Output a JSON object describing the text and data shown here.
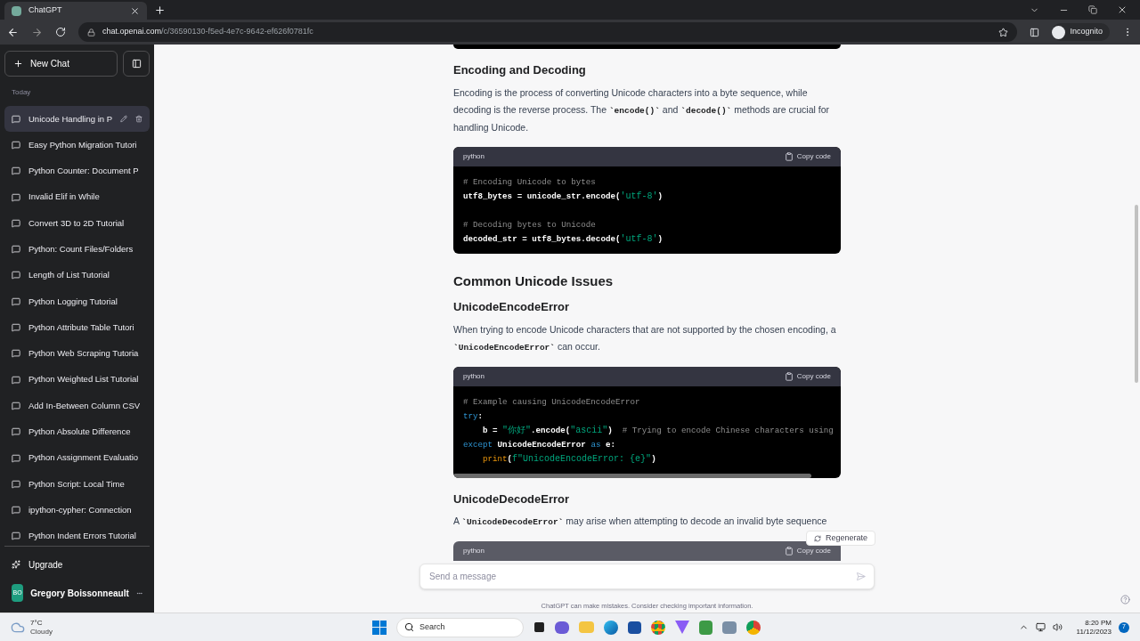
{
  "browser": {
    "tab_title": "ChatGPT",
    "url_host": "chat.openai.com",
    "url_path": "/c/36590130-f5ed-4e7c-9642-ef626f0781fc",
    "profile": "Incognito"
  },
  "sidebar": {
    "new_chat": "New Chat",
    "section": "Today",
    "items": [
      {
        "title": "Unicode Handling in P",
        "selected": true
      },
      {
        "title": "Easy Python Migration Tutori",
        "selected": false
      },
      {
        "title": "Python Counter: Document P",
        "selected": false
      },
      {
        "title": "Invalid Elif in While",
        "selected": false
      },
      {
        "title": "Convert 3D to 2D Tutorial",
        "selected": false
      },
      {
        "title": "Python: Count Files/Folders",
        "selected": false
      },
      {
        "title": "Length of List Tutorial",
        "selected": false
      },
      {
        "title": "Python Logging Tutorial",
        "selected": false
      },
      {
        "title": "Python Attribute Table Tutori",
        "selected": false
      },
      {
        "title": "Python Web Scraping Tutoria",
        "selected": false
      },
      {
        "title": "Python Weighted List Tutorial",
        "selected": false
      },
      {
        "title": "Add In-Between Column CSV",
        "selected": false
      },
      {
        "title": "Python Absolute Difference",
        "selected": false
      },
      {
        "title": "Python Assignment Evaluatio",
        "selected": false
      },
      {
        "title": "Python Script: Local Time",
        "selected": false
      },
      {
        "title": "ipython-cypher: Connection",
        "selected": false
      },
      {
        "title": "Python Indent Errors Tutorial",
        "selected": false
      }
    ],
    "upgrade": "Upgrade",
    "user": {
      "initials": "BO",
      "name": "Gregory Boissonneault"
    }
  },
  "content": [
    {
      "kind": "h3",
      "text": "Encoding and Decoding"
    },
    {
      "kind": "p",
      "parts": [
        {
          "kind": "text",
          "text": "Encoding is the process of converting Unicode characters into a byte sequence, while decoding is the reverse process. The "
        },
        {
          "kind": "code",
          "text": "`encode()`"
        },
        {
          "kind": "text",
          "text": " and "
        },
        {
          "kind": "code",
          "text": "`decode()`"
        },
        {
          "kind": "text",
          "text": " methods are crucial for handling Unicode."
        }
      ]
    },
    {
      "kind": "code",
      "language": "python",
      "copy": "Copy code",
      "scrollbar": false,
      "lines": [
        {
          "kind": "code",
          "indented": false,
          "tokens": [
            {
              "kind": "comment",
              "text": "# Encoding Unicode to bytes"
            }
          ]
        },
        {
          "kind": "code",
          "indented": false,
          "tokens": [
            {
              "kind": "plain",
              "text": "utf8_bytes = unicode_str.encode("
            },
            {
              "kind": "string",
              "text": "'utf-8'"
            },
            {
              "kind": "plain",
              "text": ")"
            }
          ]
        },
        {
          "kind": "blank"
        },
        {
          "kind": "code",
          "indented": false,
          "tokens": [
            {
              "kind": "comment",
              "text": "# Decoding bytes to Unicode"
            }
          ]
        },
        {
          "kind": "code",
          "indented": false,
          "tokens": [
            {
              "kind": "plain",
              "text": "decoded_str = utf8_bytes.decode("
            },
            {
              "kind": "string",
              "text": "'utf-8'"
            },
            {
              "kind": "plain",
              "text": ")"
            }
          ]
        }
      ]
    },
    {
      "kind": "h2",
      "text": "Common Unicode Issues"
    },
    {
      "kind": "h3",
      "text": "UnicodeEncodeError"
    },
    {
      "kind": "p",
      "parts": [
        {
          "kind": "text",
          "text": "When trying to encode Unicode characters that are not supported by the chosen encoding, a "
        },
        {
          "kind": "code",
          "text": "`UnicodeEncodeError`"
        },
        {
          "kind": "text",
          "text": " can occur."
        }
      ]
    },
    {
      "kind": "code",
      "language": "python",
      "copy": "Copy code",
      "scrollbar": true,
      "lines": [
        {
          "kind": "code",
          "indented": false,
          "tokens": [
            {
              "kind": "comment",
              "text": "# Example causing UnicodeEncodeError"
            }
          ]
        },
        {
          "kind": "code",
          "indented": false,
          "tokens": [
            {
              "kind": "keyword",
              "text": "try"
            },
            {
              "kind": "plain",
              "text": ":"
            }
          ]
        },
        {
          "kind": "code",
          "indented": true,
          "tokens": [
            {
              "kind": "plain",
              "text": "b = "
            },
            {
              "kind": "string",
              "text": "\"你好\""
            },
            {
              "kind": "plain",
              "text": ".encode("
            },
            {
              "kind": "string",
              "text": "\"ascii\""
            },
            {
              "kind": "plain",
              "text": ")  "
            },
            {
              "kind": "comment",
              "text": "# Trying to encode Chinese characters using"
            }
          ]
        },
        {
          "kind": "code",
          "indented": false,
          "tokens": [
            {
              "kind": "keyword",
              "text": "except"
            },
            {
              "kind": "plain",
              "text": " UnicodeEncodeError "
            },
            {
              "kind": "keyword",
              "text": "as"
            },
            {
              "kind": "plain",
              "text": " e:"
            }
          ]
        },
        {
          "kind": "code",
          "indented": true,
          "tokens": [
            {
              "kind": "builtin",
              "text": "print"
            },
            {
              "kind": "plain",
              "text": "("
            },
            {
              "kind": "string",
              "text": "f\"UnicodeEncodeError: {e}\""
            },
            {
              "kind": "plain",
              "text": ")"
            }
          ]
        }
      ]
    },
    {
      "kind": "h3",
      "text": "UnicodeDecodeError"
    },
    {
      "kind": "p",
      "parts": [
        {
          "kind": "text",
          "text": "A "
        },
        {
          "kind": "code",
          "text": "`UnicodeDecodeError`"
        },
        {
          "kind": "text",
          "text": " may arise when attempting to decode an invalid byte sequence"
        }
      ]
    },
    {
      "kind": "code_header",
      "language": "python",
      "copy": "Copy code"
    }
  ],
  "regenerate": "Regenerate",
  "composer": {
    "placeholder": "Send a message"
  },
  "disclaimer": "ChatGPT can make mistakes. Consider checking important information.",
  "taskbar": {
    "temperature": "7°C",
    "weather": "Cloudy",
    "search": "Search",
    "time": "8:20 PM",
    "date": "11/12/2023",
    "notifications": "7"
  }
}
